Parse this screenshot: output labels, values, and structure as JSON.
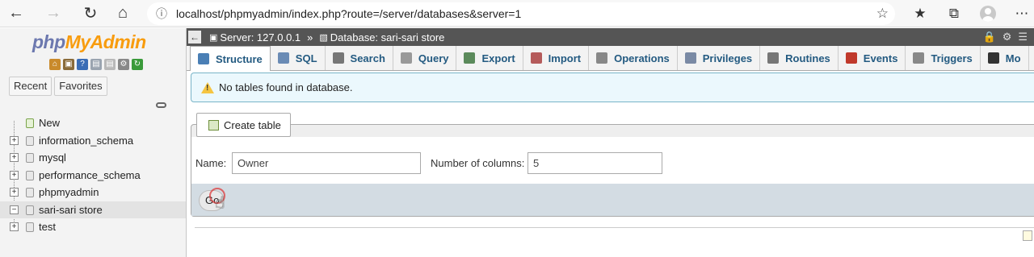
{
  "browser": {
    "url": "localhost/phpmyadmin/index.php?route=/server/databases&server=1"
  },
  "sidebar": {
    "logo_php": "php",
    "logo_myadmin": "MyAdmin",
    "recent_label": "Recent",
    "favorites_label": "Favorites",
    "tree": [
      {
        "label": "New",
        "type": "new"
      },
      {
        "label": "information_schema",
        "type": "db"
      },
      {
        "label": "mysql",
        "type": "db"
      },
      {
        "label": "performance_schema",
        "type": "db"
      },
      {
        "label": "phpmyadmin",
        "type": "db"
      },
      {
        "label": "sari-sari store",
        "type": "db",
        "selected": true
      },
      {
        "label": "test",
        "type": "db"
      }
    ]
  },
  "breadcrumb": {
    "server": "Server: 127.0.0.1",
    "separator": "»",
    "database": "Database: sari-sari store"
  },
  "tabs": [
    {
      "label": "Structure",
      "active": true,
      "icon": "structure-icon",
      "color": "#4a7fb5"
    },
    {
      "label": "SQL",
      "icon": "sql-icon",
      "color": "#6a8bb5"
    },
    {
      "label": "Search",
      "icon": "search-icon",
      "color": "#777777"
    },
    {
      "label": "Query",
      "icon": "query-icon",
      "color": "#999999"
    },
    {
      "label": "Export",
      "icon": "export-icon",
      "color": "#5b8a5b"
    },
    {
      "label": "Import",
      "icon": "import-icon",
      "color": "#b55b5b"
    },
    {
      "label": "Operations",
      "icon": "wrench-icon",
      "color": "#888888"
    },
    {
      "label": "Privileges",
      "icon": "privileges-icon",
      "color": "#7a8aa5"
    },
    {
      "label": "Routines",
      "icon": "routines-icon",
      "color": "#777777"
    },
    {
      "label": "Events",
      "icon": "clock-icon",
      "color": "#c0392b"
    },
    {
      "label": "Triggers",
      "icon": "triggers-icon",
      "color": "#888888"
    },
    {
      "label": "Mo",
      "icon": "more-icon",
      "color": "#333333"
    }
  ],
  "notice": {
    "text": "No tables found in database."
  },
  "create_table": {
    "legend": "Create table",
    "name_label": "Name:",
    "name_value": "Owner",
    "columns_label": "Number of columns:",
    "columns_value": "5",
    "go_label": "Go"
  }
}
